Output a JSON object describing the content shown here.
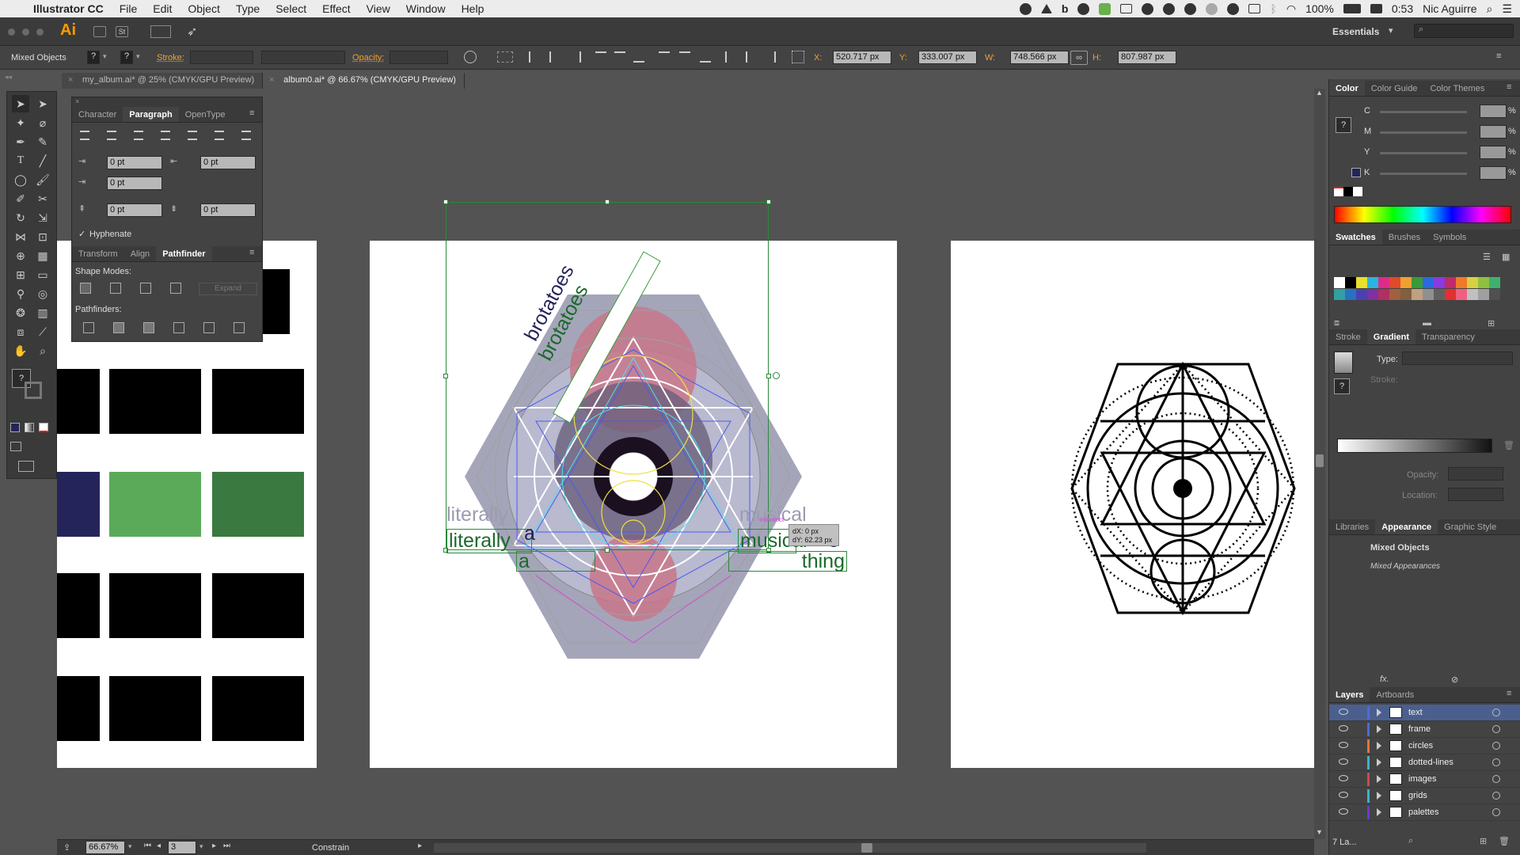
{
  "menubar": {
    "app_name": "Illustrator CC",
    "items": [
      "File",
      "Edit",
      "Object",
      "Type",
      "Select",
      "Effect",
      "View",
      "Window",
      "Help"
    ],
    "battery": "100%",
    "time": "0:53",
    "user": "Nic Aguirre"
  },
  "appbar": {
    "logo": "Ai",
    "st_label": "St",
    "workspace": "Essentials"
  },
  "control": {
    "selection_label": "Mixed Objects",
    "stroke_label": "Stroke:",
    "opacity_label": "Opacity:",
    "x_label": "X:",
    "x_value": "520.717 px",
    "y_label": "Y:",
    "y_value": "333.007 px",
    "w_label": "W:",
    "w_value": "748.566 px",
    "h_label": "H:",
    "h_value": "807.987 px",
    "help_glyph": "?"
  },
  "doc_tabs": [
    {
      "label": "my_album.ai* @ 25% (CMYK/GPU Preview)"
    },
    {
      "label": "album0.ai* @ 66.67% (CMYK/GPU Preview)"
    }
  ],
  "paragraph_panel": {
    "tabs": [
      "Character",
      "Paragraph",
      "OpenType"
    ],
    "indent_left": "0 pt",
    "indent_right": "0 pt",
    "first_line": "0 pt",
    "space_before": "0 pt",
    "space_after": "0 pt",
    "hyphenate_label": "Hyphenate"
  },
  "pathfinder_panel": {
    "tabs": [
      "Transform",
      "Align",
      "Pathfinder"
    ],
    "shape_modes_label": "Shape Modes:",
    "expand_label": "Expand",
    "pathfinders_label": "Pathfinders:"
  },
  "canvas": {
    "text_bro_1": "brotatoes",
    "text_bro_2": "brotatoes",
    "literally_gray": "literally",
    "literally_green": "literally",
    "musical_gray": "musical",
    "musical_green": "musical",
    "thing_navy": "thing",
    "thing_green": "thing",
    "a_navy": "a",
    "a_green": "a",
    "smart_guide_label": "intersect",
    "dx": "dX: 0 px",
    "dy": "dY: 62.23 px"
  },
  "color_panel": {
    "tabs": [
      "Color",
      "Color Guide",
      "Color Themes"
    ],
    "channels": [
      "C",
      "M",
      "Y",
      "K"
    ],
    "percent": "%"
  },
  "swatches_panel": {
    "tabs": [
      "Swatches",
      "Brushes",
      "Symbols"
    ]
  },
  "gradient_panel": {
    "tabs": [
      "Stroke",
      "Gradient",
      "Transparency"
    ],
    "type_label": "Type:",
    "stroke_label": "Stroke:",
    "opacity_label": "Opacity:",
    "location_label": "Location:"
  },
  "appearance_panel": {
    "tabs": [
      "Libraries",
      "Appearance",
      "Graphic Style"
    ],
    "title": "Mixed Objects",
    "subtitle": "Mixed Appearances",
    "fx_label": "fx."
  },
  "layers_panel": {
    "tabs": [
      "Layers",
      "Artboards"
    ],
    "layers": [
      {
        "name": "text",
        "color": "#4b6cd6",
        "selected": true
      },
      {
        "name": "frame",
        "color": "#4b6cd6",
        "selected": false
      },
      {
        "name": "circles",
        "color": "#e0763a",
        "selected": false
      },
      {
        "name": "dotted-lines",
        "color": "#3ab4c8",
        "selected": false
      },
      {
        "name": "images",
        "color": "#d04a4a",
        "selected": false
      },
      {
        "name": "grids",
        "color": "#3ab4c8",
        "selected": false
      },
      {
        "name": "palettes",
        "color": "#6a3ad0",
        "selected": false
      }
    ],
    "footer": "7 La..."
  },
  "status": {
    "zoom": "66.67%",
    "artboard_num": "3",
    "mode": "Constrain"
  }
}
